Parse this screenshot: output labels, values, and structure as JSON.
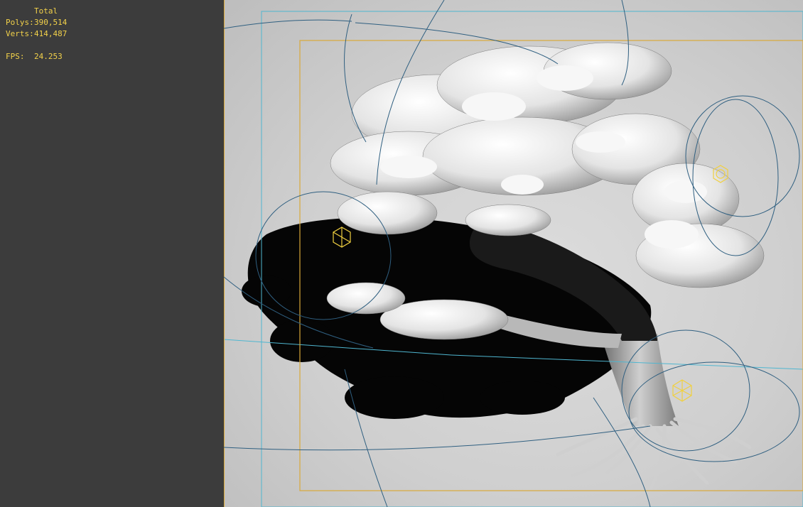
{
  "stats": {
    "header": "Total",
    "polys_label": "Polys:",
    "polys_value": "390,514",
    "verts_label": "Verts:",
    "verts_value": "414,487",
    "fps_label": "FPS:",
    "fps_value": "24.253"
  },
  "colors": {
    "overlay_text": "#f2d14a",
    "panel_bg": "#3c3c3c",
    "viewport_bg": "#d0d0d0",
    "safe_frame": "#d9a93a",
    "camera_frame": "#4fb6d0",
    "light_gizmo": "#f0d040",
    "light_spline": "#2f5f80"
  },
  "viewport": {
    "object": "bonsai tree",
    "icons": [
      "light-gizmo-icon",
      "light-gizmo-icon",
      "light-gizmo-icon"
    ]
  }
}
